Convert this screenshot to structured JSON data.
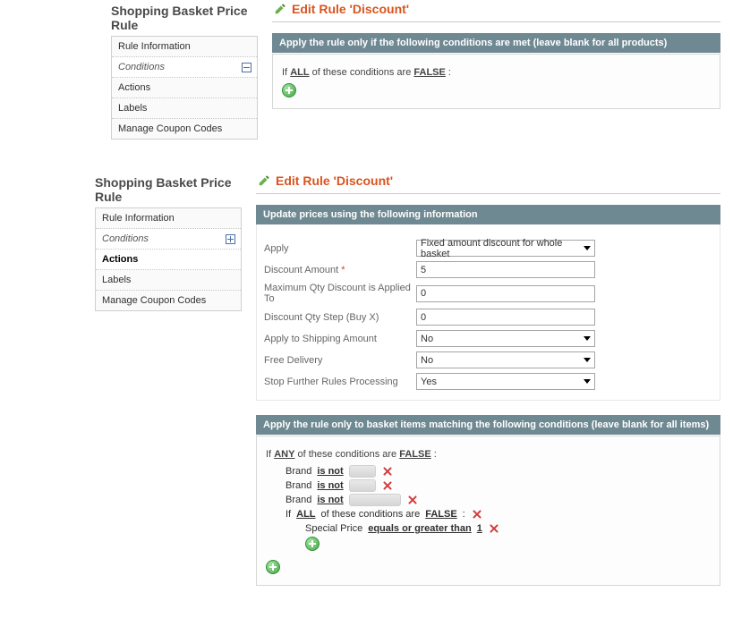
{
  "block1": {
    "sidebar": {
      "title": "Shopping Basket Price Rule",
      "items": [
        {
          "label": "Rule Information"
        },
        {
          "label": "Conditions",
          "selected": true
        },
        {
          "label": "Actions"
        },
        {
          "label": "Labels"
        },
        {
          "label": "Manage Coupon Codes"
        }
      ]
    },
    "title": "Edit Rule 'Discount'",
    "bar": "Apply the rule only if the following conditions are met (leave blank for all products)",
    "cond": {
      "if_word": "If",
      "aggregator": "ALL",
      "of_these": "of these conditions are",
      "value": "FALSE",
      "colon": ":"
    }
  },
  "block2": {
    "sidebar": {
      "title": "Shopping Basket Price Rule",
      "items": [
        {
          "label": "Rule Information"
        },
        {
          "label": "Conditions",
          "mini": true
        },
        {
          "label": "Actions",
          "selected": true
        },
        {
          "label": "Labels"
        },
        {
          "label": "Manage Coupon Codes"
        }
      ]
    },
    "title": "Edit Rule 'Discount'",
    "bar": "Update prices using the following information",
    "form": {
      "apply": {
        "label": "Apply",
        "value": "Fixed amount discount for whole basket"
      },
      "discount_amount": {
        "label": "Discount Amount",
        "required": "*",
        "value": "5"
      },
      "max_qty": {
        "label": "Maximum Qty Discount is Applied To",
        "value": "0"
      },
      "qty_step": {
        "label": "Discount Qty Step (Buy X)",
        "value": "0"
      },
      "shipping": {
        "label": "Apply to Shipping Amount",
        "value": "No"
      },
      "free_delivery": {
        "label": "Free Delivery",
        "value": "No"
      },
      "stop_rules": {
        "label": "Stop Further Rules Processing",
        "value": "Yes"
      }
    },
    "bar2": "Apply the rule only to basket items matching the following conditions (leave blank for all items)",
    "cond": {
      "if_word": "If",
      "aggregator": "ANY",
      "of_these": "of these conditions are",
      "value": "FALSE",
      "colon": ":",
      "lines": [
        {
          "attr": "Brand",
          "op": "is not"
        },
        {
          "attr": "Brand",
          "op": "is not"
        },
        {
          "attr": "Brand",
          "op": "is not"
        }
      ],
      "nested": {
        "if_word": "If",
        "aggregator": "ALL",
        "of_these": "of these conditions are",
        "value": "FALSE",
        "colon": ":",
        "line": {
          "attr": "Special Price",
          "op": "equals or greater than",
          "val": "1"
        }
      }
    }
  }
}
